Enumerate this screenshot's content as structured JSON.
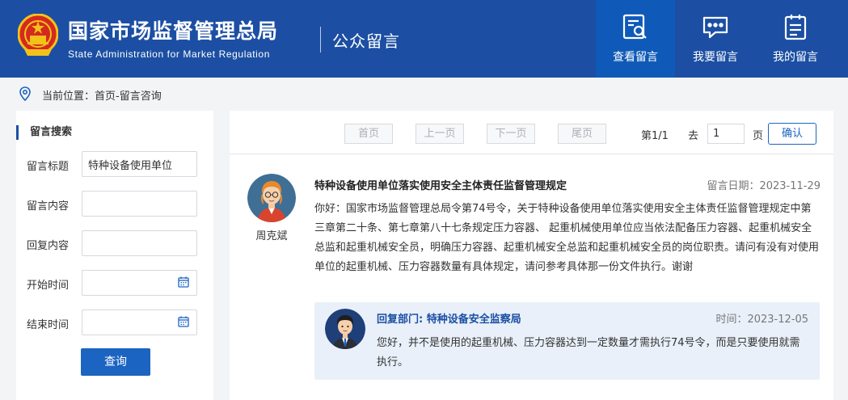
{
  "header": {
    "title_cn": "国家市场监督管理总局",
    "title_en": "State Administration for Market Regulation",
    "section": "公众留言",
    "nav": [
      {
        "label": "查看留言",
        "icon": "search-document-icon",
        "active": true
      },
      {
        "label": "我要留言",
        "icon": "chat-bubble-icon",
        "active": false
      },
      {
        "label": "我的留言",
        "icon": "clipboard-list-icon",
        "active": false
      }
    ]
  },
  "breadcrumb": {
    "text": "当前位置：首页-留言咨询"
  },
  "search": {
    "title": "留言搜索",
    "fields": [
      {
        "label": "留言标题",
        "value": "特种设备使用单位"
      },
      {
        "label": "留言内容",
        "value": ""
      },
      {
        "label": "回复内容",
        "value": ""
      },
      {
        "label": "开始时间",
        "value": ""
      },
      {
        "label": "结束时间",
        "value": ""
      }
    ],
    "submit_label": "查询"
  },
  "pager": {
    "first": "首页",
    "prev": "上一页",
    "next": "下一页",
    "last": "尾页",
    "page_info": "第1/1",
    "goto_label": "去",
    "page_input": "1",
    "page_unit": "页",
    "confirm": "确认"
  },
  "message": {
    "author": "周克斌",
    "title": "特种设备使用单位落实使用安全主体责任监督管理规定",
    "date": "留言日期：2023-11-29",
    "body": "你好：国家市场监督管理总局令第74号令，关于特种设备使用单位落实使用安全主体责任监督管理规定中第三章第二十条、第七章第八十七条规定压力容器、 起重机械使用单位应当依法配备压力容器、起重机械安全总监和起重机械安全员，明确压力容器、起重机械安全总监和起重机械安全员的岗位职责。请问有没有对使用单位的起重机械、压力容器数量有具体规定，请问参考具体那一份文件执行。谢谢"
  },
  "reply": {
    "dept": "回复部门: 特种设备安全监察局",
    "time": "时间：2023-12-05",
    "body": "您好，并不是使用的起重机械、压力容器达到一定数量才需执行74号令，而是只要使用就需执行。"
  },
  "colors": {
    "header_bg": "#1c4fa3",
    "nav_active": "#0f5ab8",
    "accent": "#1c64c1",
    "reply_bg": "#e9f0fa"
  }
}
